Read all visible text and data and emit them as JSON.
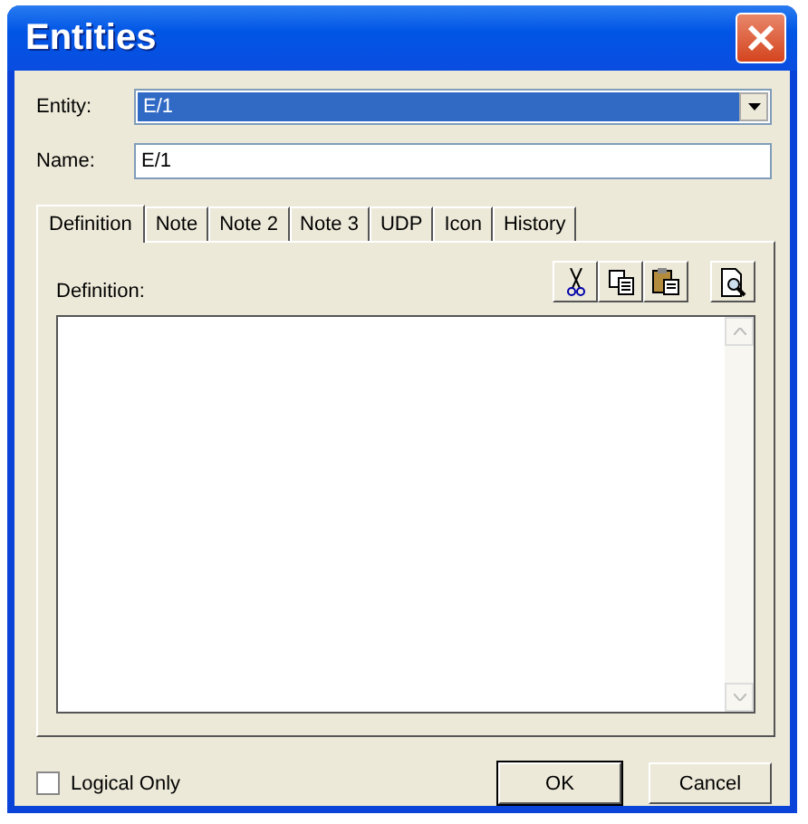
{
  "window": {
    "title": "Entities"
  },
  "entity": {
    "label": "Entity:",
    "value": "E/1"
  },
  "name": {
    "label": "Name:",
    "value": "E/1"
  },
  "tabs": [
    {
      "label": "Definition",
      "selected": true
    },
    {
      "label": "Note",
      "selected": false
    },
    {
      "label": "Note 2",
      "selected": false
    },
    {
      "label": "Note 3",
      "selected": false
    },
    {
      "label": "UDP",
      "selected": false
    },
    {
      "label": "Icon",
      "selected": false
    },
    {
      "label": "History",
      "selected": false
    }
  ],
  "definition": {
    "label": "Definition:"
  },
  "logical_only": {
    "label": "Logical Only",
    "checked": false
  },
  "buttons": [
    {
      "label": "OK",
      "kind": "default"
    },
    {
      "label": "Cancel",
      "kind": "normal"
    }
  ]
}
